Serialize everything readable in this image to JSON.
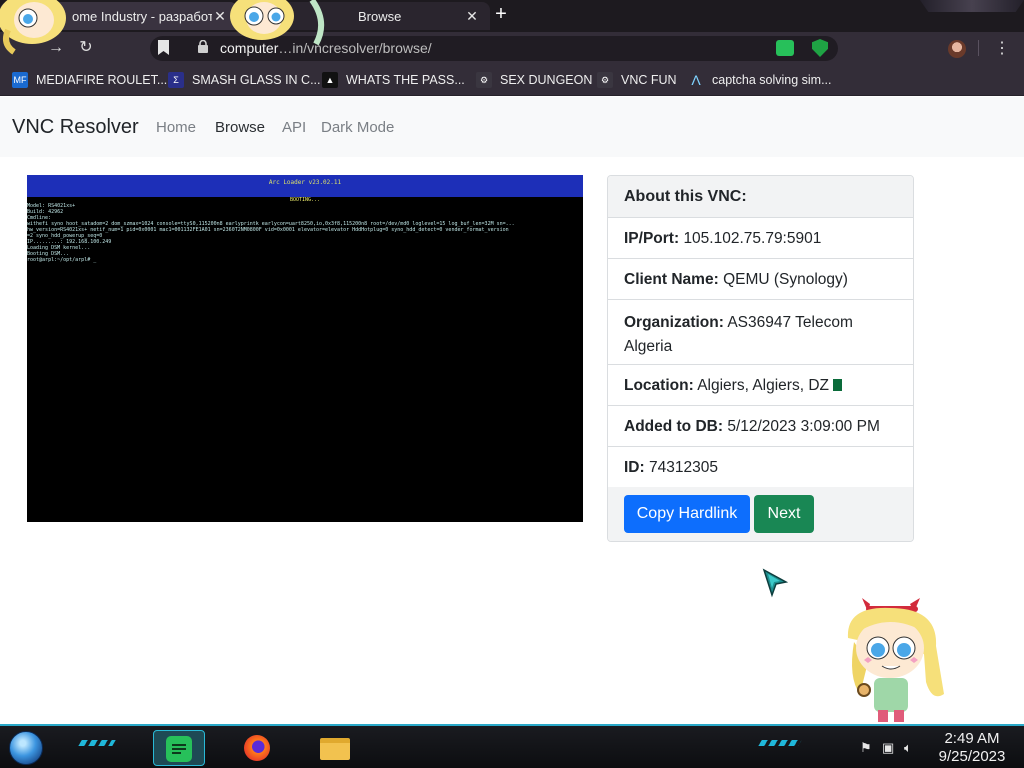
{
  "browser": {
    "tabs": [
      {
        "title": "ome Industry - разработк"
      },
      {
        "title": "Browse"
      }
    ],
    "address": {
      "host": "computer",
      "path": "in/vncresolver/browse/"
    },
    "bookmarks": [
      {
        "label": "MEDIAFIRE ROULET...",
        "icon": "MF"
      },
      {
        "label": "SMASH GLASS IN C..."
      },
      {
        "label": "WHATS THE PASS..."
      },
      {
        "label": "SEX DUNGEON"
      },
      {
        "label": "VNC FUN"
      },
      {
        "label": "captcha solving sim..."
      }
    ]
  },
  "site": {
    "brand": "VNC Resolver",
    "nav": [
      {
        "label": "Home"
      },
      {
        "label": "Browse"
      },
      {
        "label": "API"
      },
      {
        "label": "Dark Mode"
      }
    ]
  },
  "vnc_screen": {
    "title": "Arc Loader v23.02.11",
    "status": "BOOTING...",
    "lines": [
      "Model: RS4021xs+",
      "Build: 42962",
      "Cmdline:",
      "withefi syno hoot_satadom=2 dom_szmax=1024 console=ttyS0,115200n8 earlyprintk earlycon=uart8250,io,0x3f8,115200n8 root=/dev/md0 loglevel=15 log_buf_len=32M sn=...",
      "hw_version=RS4021xs+ netif_num=1 pid=0x0001 mac1=001132FE1A01 sn=2360T2NM0800F vid=0x0001 elevator=elevator HddHotplug=0 syno_hdd_detect=0 vender_format_version",
      "=2 syno_hdd_powerup_seq=0",
      "IP.........: 192.168.100.249",
      "Loading DSM kernel...",
      "Booting DSM...",
      "root@arpl:~/opt/arpl# _"
    ]
  },
  "about": {
    "header": "About this VNC:",
    "items": [
      {
        "label": "IP/Port:",
        "value": "105.102.75.79:5901"
      },
      {
        "label": "Client Name:",
        "value": "QEMU (Synology)"
      },
      {
        "label": "Organization:",
        "value": "AS36947 Telecom Algeria"
      },
      {
        "label": "Location:",
        "value": "Algiers, Algiers, DZ"
      },
      {
        "label": "Added to DB:",
        "value": "5/12/2023 3:09:00 PM"
      },
      {
        "label": "ID:",
        "value": "74312305"
      }
    ],
    "buttons": {
      "copy": "Copy Hardlink",
      "next": "Next"
    }
  },
  "taskbar": {
    "clock_time": "2:49 AM",
    "clock_date": "9/25/2023"
  }
}
